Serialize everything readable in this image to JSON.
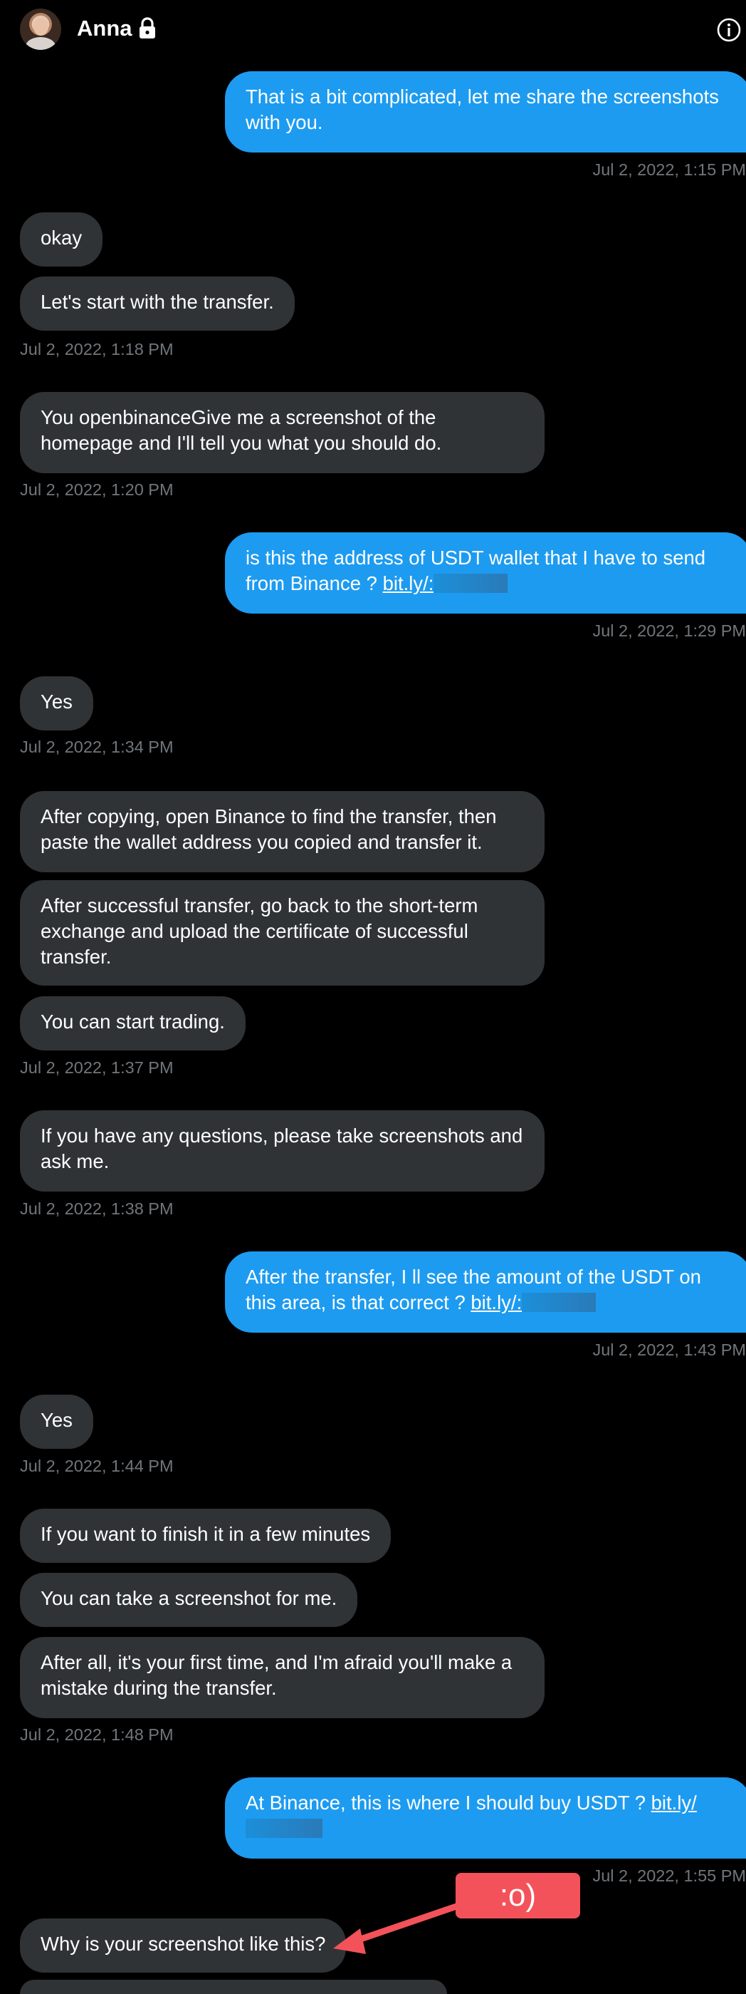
{
  "header": {
    "name": "Anna",
    "icons": [
      "avatar",
      "lock-icon",
      "info-icon"
    ]
  },
  "messages": [
    {
      "side": "sent",
      "text": "That is a bit complicated, let me share the screenshots with you."
    },
    {
      "side": "time-right",
      "text": "Jul 2, 2022, 1:15 PM"
    },
    {
      "side": "recv",
      "text": "okay"
    },
    {
      "side": "recv",
      "text": "Let's start with the transfer."
    },
    {
      "side": "time-left",
      "text": "Jul 2, 2022, 1:18 PM"
    },
    {
      "side": "recv",
      "text": "You openbinanceGive me a screenshot of the homepage and I'll tell you what you should do."
    },
    {
      "side": "time-left",
      "text": "Jul 2, 2022, 1:20 PM"
    },
    {
      "side": "sent",
      "text": "is this the address of USDT wallet that I have to send from Binance ?",
      "link": "bit.ly/:"
    },
    {
      "side": "time-right",
      "text": "Jul 2, 2022, 1:29 PM"
    },
    {
      "side": "recv",
      "text": "Yes"
    },
    {
      "side": "time-left",
      "text": "Jul 2, 2022, 1:34 PM"
    },
    {
      "side": "recv",
      "text": "After copying, open Binance to find the transfer, then paste the wallet address you copied and transfer it."
    },
    {
      "side": "recv",
      "text": "After successful transfer, go back to the short-term exchange and upload the certificate of successful transfer."
    },
    {
      "side": "recv",
      "text": "You can start trading."
    },
    {
      "side": "time-left",
      "text": "Jul 2, 2022, 1:37 PM"
    },
    {
      "side": "recv",
      "text": "If you have any questions, please take screenshots and ask me."
    },
    {
      "side": "time-left",
      "text": "Jul 2, 2022, 1:38 PM"
    },
    {
      "side": "sent",
      "text": "After the transfer, I ll see the amount of the USDT on this area, is that correct ?",
      "link": "bit.ly/:"
    },
    {
      "side": "time-right",
      "text": "Jul 2, 2022, 1:43 PM"
    },
    {
      "side": "recv",
      "text": "Yes"
    },
    {
      "side": "time-left",
      "text": "Jul 2, 2022, 1:44 PM"
    },
    {
      "side": "recv",
      "text": "If you want to finish it in a few minutes"
    },
    {
      "side": "recv",
      "text": "You can take a screenshot for me."
    },
    {
      "side": "recv",
      "text": "After all, it's your first time, and I'm afraid you'll make a mistake during the transfer."
    },
    {
      "side": "time-left",
      "text": "Jul 2, 2022, 1:48 PM"
    },
    {
      "side": "sent",
      "text": "At Binance, this is where I should buy USDT ?",
      "link": "bit.ly/"
    },
    {
      "side": "time-right",
      "text": "Jul 2, 2022, 1:55 PM"
    },
    {
      "side": "recv",
      "text": "Why is your screenshot like this?"
    }
  ],
  "annotation": {
    "text": ":o)",
    "color": "#f3525a"
  },
  "colors": {
    "background": "#000000",
    "received_bubble": "#2f3336",
    "sent_bubble": "#1d9bf0",
    "timestamp": "#71767b"
  }
}
